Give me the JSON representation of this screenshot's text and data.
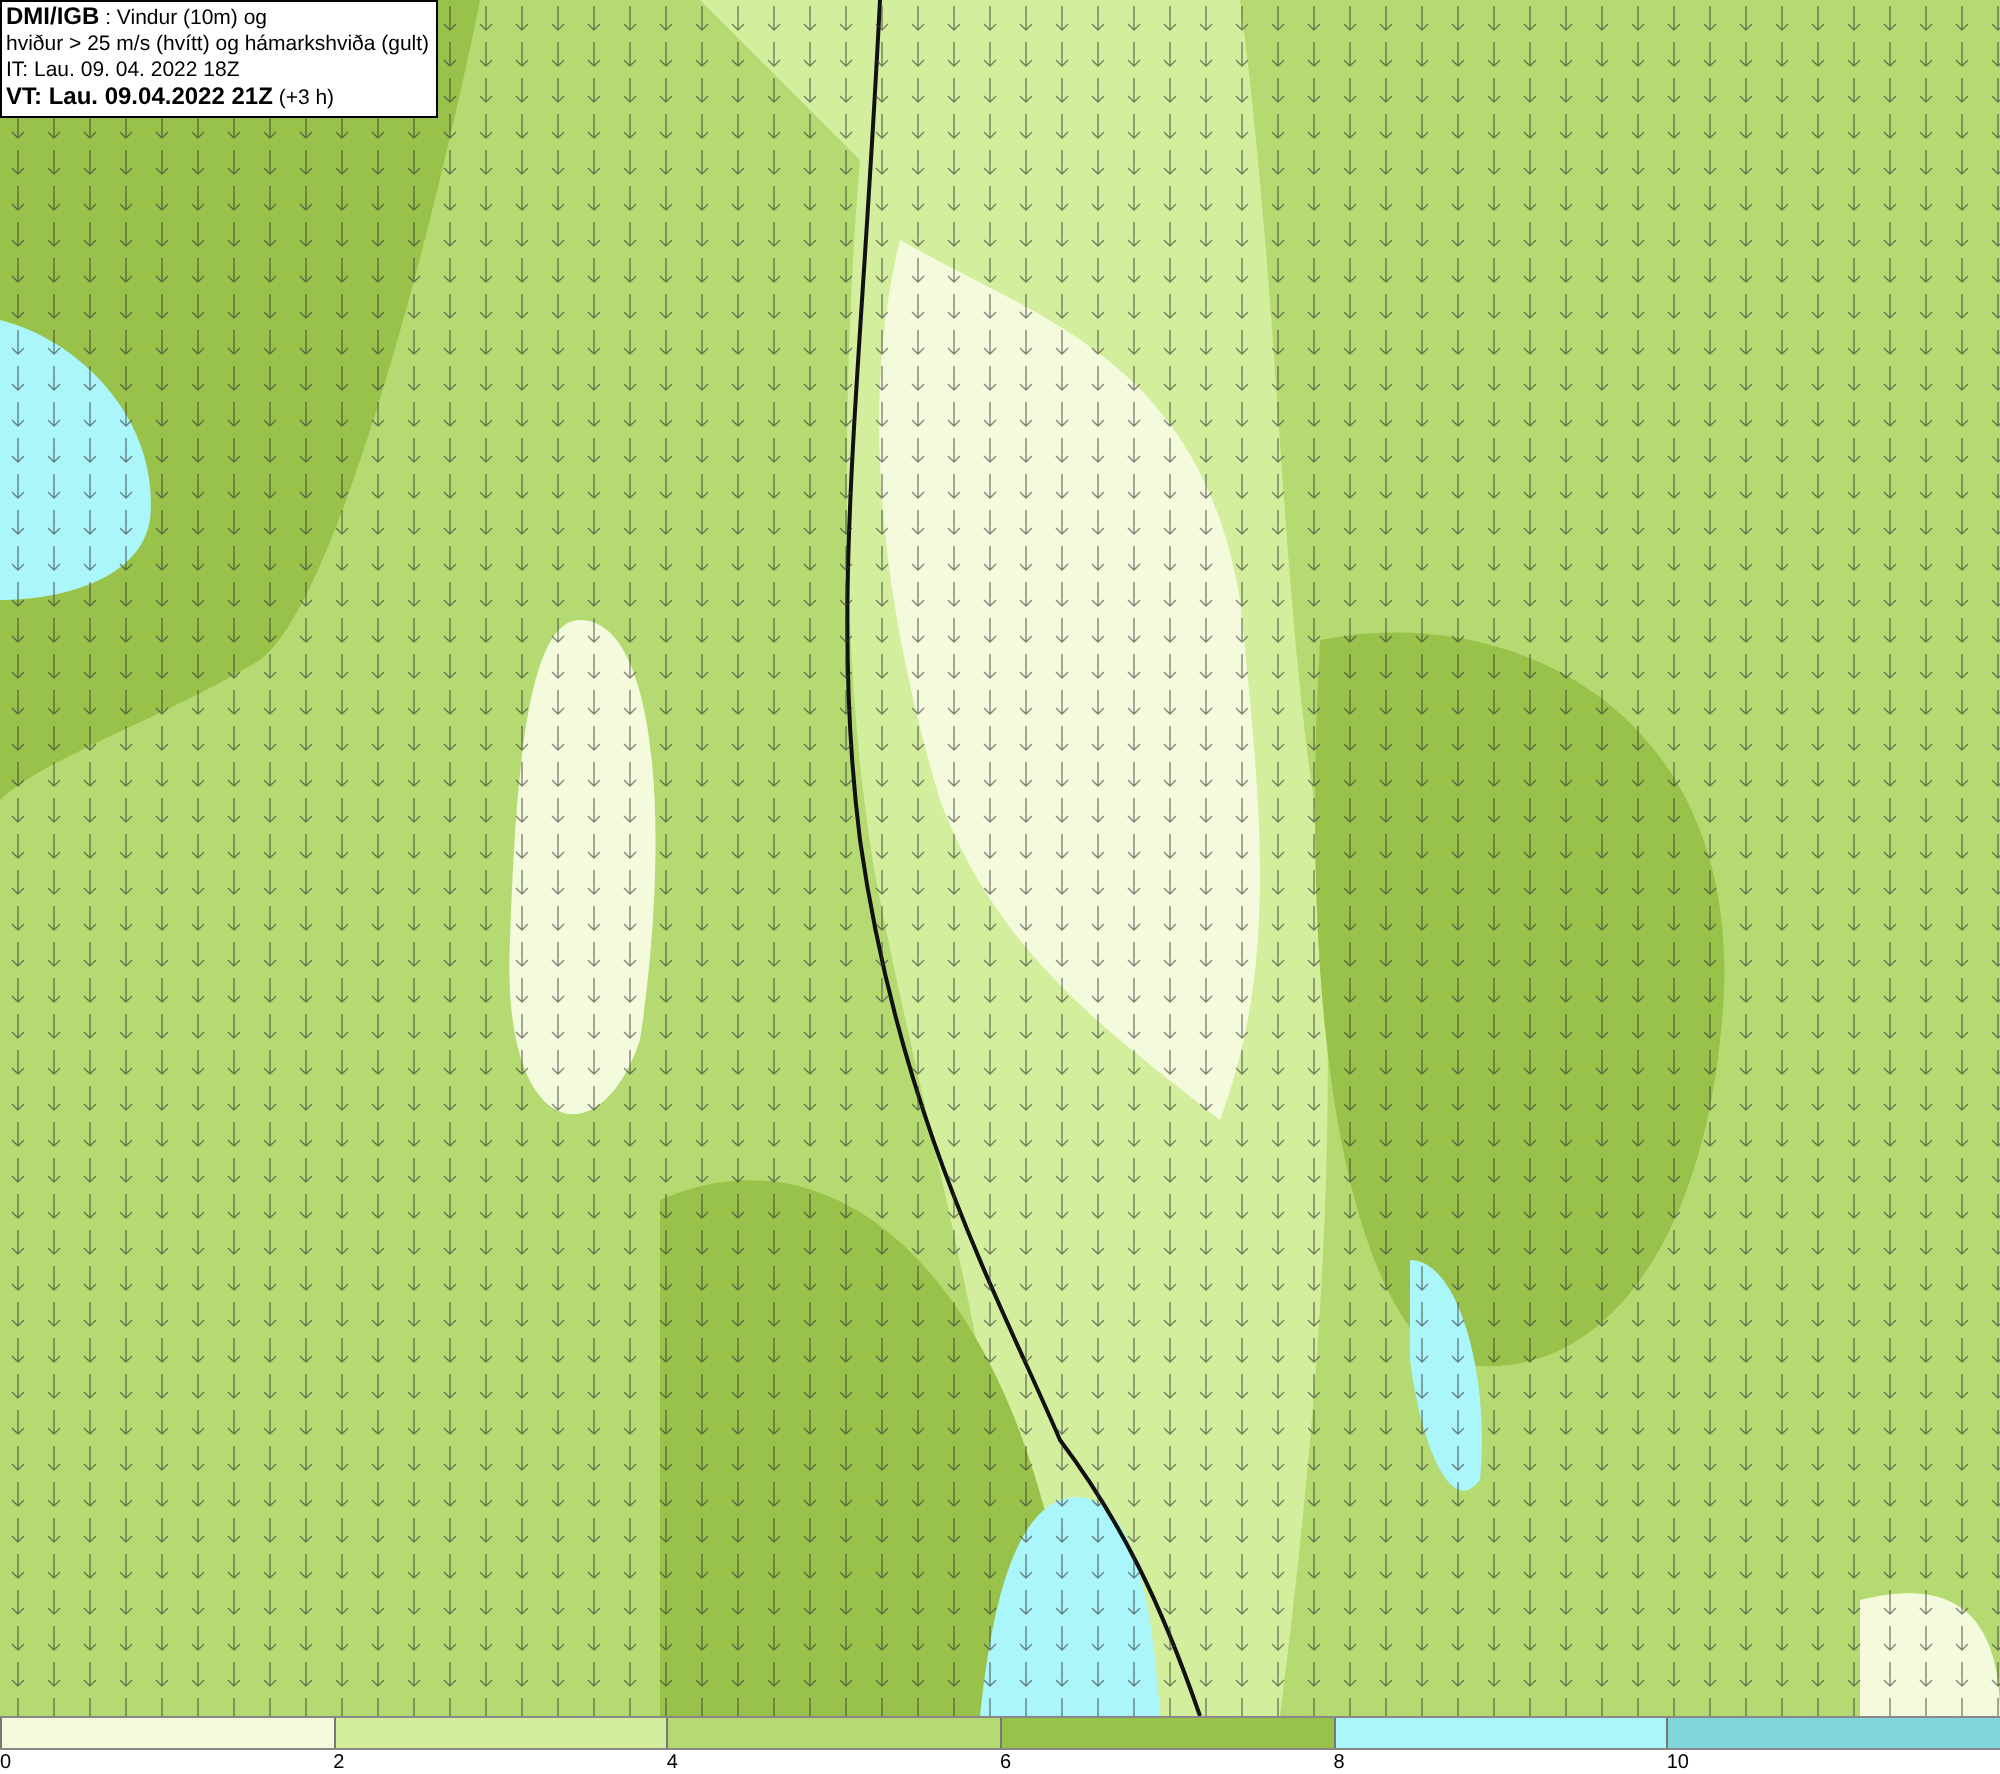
{
  "info_box": {
    "lines": [
      "**DMI/IGB** : Vindur (10m) og",
      "hviður > 25 m/s (hvítt) og hámarkshviða (gult)",
      "IT: Lau. 09. 04. 2022 18Z",
      "**VT: Lau. 09.04.2022 21Z** (+3 h)"
    ]
  },
  "color_scale": {
    "segments": [
      {
        "color": "#f4fbdc"
      },
      {
        "color": "#d3ee9c"
      },
      {
        "color": "#b5da72"
      },
      {
        "color": "#98c24a"
      },
      {
        "color": "#aaf6fb"
      },
      {
        "color": "#80d6da"
      }
    ],
    "ticks": [
      "0",
      "2",
      "4",
      "6",
      "8",
      "10"
    ]
  }
}
